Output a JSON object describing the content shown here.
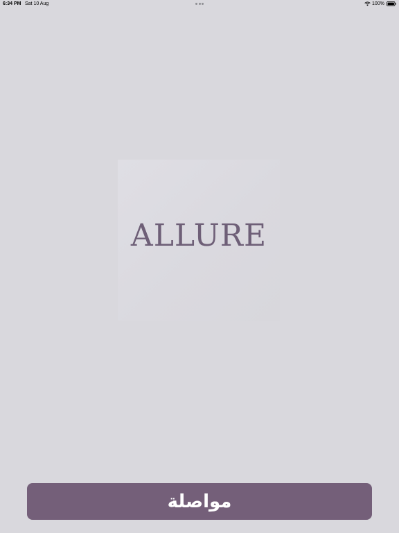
{
  "status_bar": {
    "time": "6:34 PM",
    "date": "Sat 10 Aug",
    "battery_percent": "100%",
    "icons": [
      "wifi-icon",
      "battery-icon",
      "multitask-dots-icon"
    ]
  },
  "logo": {
    "text": "ALLURE",
    "color": "#6e5f77"
  },
  "continue_button": {
    "label": "مواصلة",
    "color": "#745f79"
  },
  "colors": {
    "background": "#d9d8dd",
    "accent": "#745f79"
  }
}
